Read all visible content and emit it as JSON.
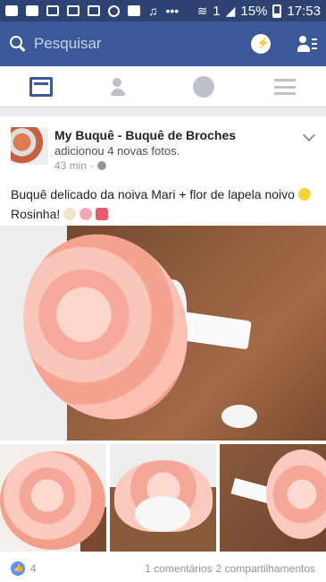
{
  "status_bar": {
    "battery_percent": "15%",
    "sim_label": "1",
    "time": "17:53"
  },
  "header": {
    "search_placeholder": "Pesquisar",
    "icons": [
      "search-icon",
      "messenger-icon",
      "friend-requests-icon"
    ]
  },
  "tabs": [
    {
      "name": "news-feed",
      "icon": "news-feed-icon",
      "active": true
    },
    {
      "name": "friends",
      "icon": "friends-icon",
      "active": false
    },
    {
      "name": "notifications",
      "icon": "globe-icon",
      "active": false
    },
    {
      "name": "menu",
      "icon": "menu-icon",
      "active": false
    }
  ],
  "post": {
    "author": "My Buquê - Buquê de Broches",
    "action": "adicionou 4 novas fotos.",
    "time": "43 min",
    "privacy_icon": "globe-icon",
    "text_line1": "Buquê delicado da noiva Mari + flor de lapela noivo",
    "text_line2": "Rosinha!",
    "likes_count": "4",
    "comments": "1 comentários",
    "shares": "2 compartilhamentos"
  },
  "colors": {
    "brand": "#3b5998",
    "status_bar": "#2d4373",
    "like": "#5890ff"
  }
}
